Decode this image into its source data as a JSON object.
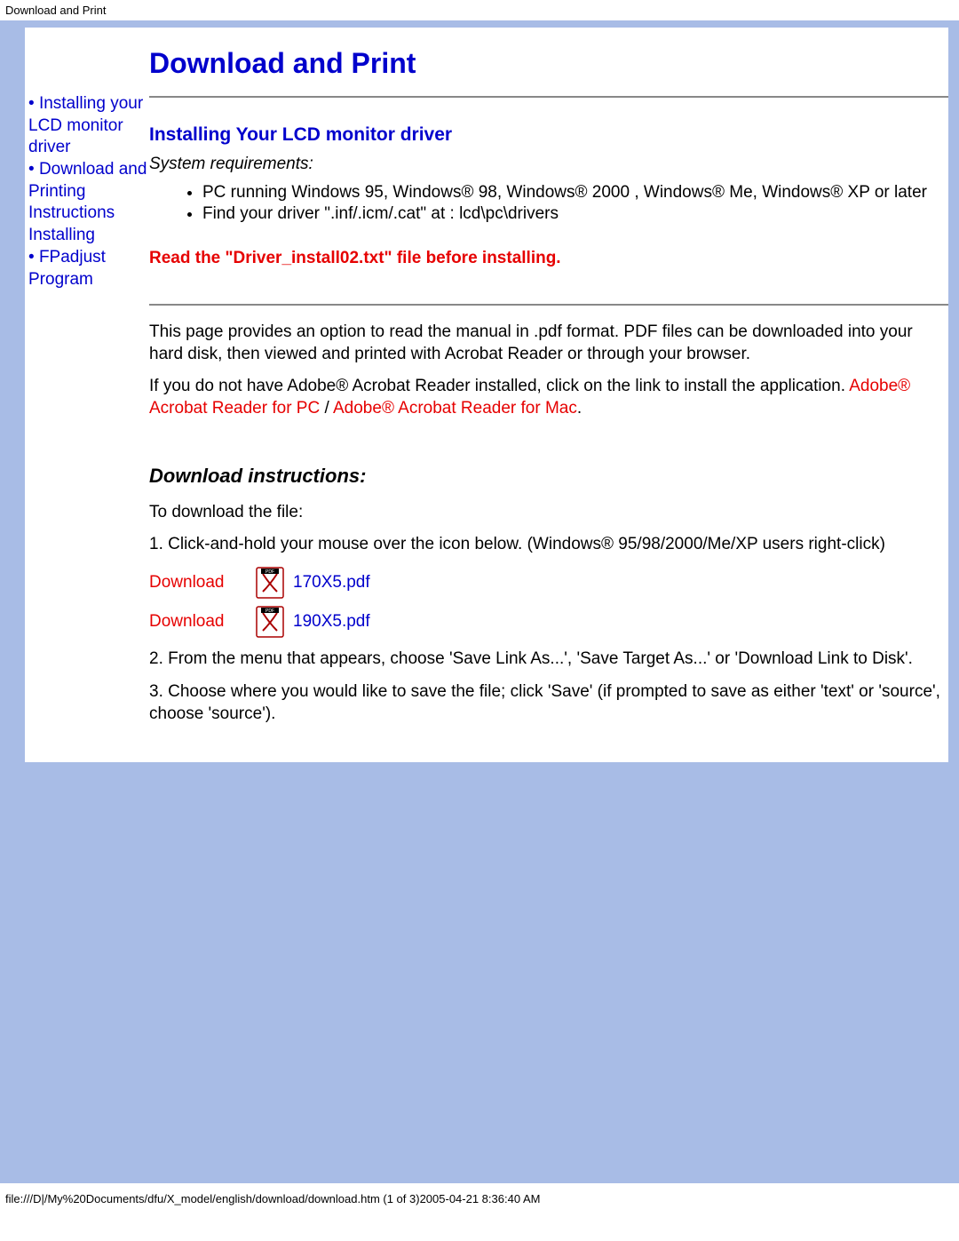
{
  "header": {
    "title_small": "Download and Print"
  },
  "sidebar": {
    "items": [
      {
        "label": "Installing your LCD monitor driver"
      },
      {
        "label": "Download and Printing Instructions Installing"
      },
      {
        "label": "FPadjust Program"
      }
    ]
  },
  "main": {
    "page_title": "Download and Print",
    "section1_title": "Installing Your LCD monitor driver",
    "system_requirements_label": "System requirements:",
    "requirements": [
      "PC running Windows 95, Windows® 98, Windows® 2000 , Windows® Me, Windows® XP or later",
      "Find your driver \".inf/.icm/.cat\" at : lcd\\pc\\drivers"
    ],
    "warning_text": "Read the \"Driver_install02.txt\" file before installing.",
    "para1": "This page provides an option to read the manual in .pdf format. PDF files can be downloaded into your hard disk, then viewed and printed with Acrobat Reader or through your browser.",
    "para2_a": "If you do not have Adobe® Acrobat Reader installed, click on the link to install the application. ",
    "acrobat_pc": "Adobe® Acrobat Reader for PC",
    "slash": " / ",
    "acrobat_mac": "Adobe® Acrobat Reader for Mac",
    "period": ".",
    "download_instructions_title": "Download instructions:",
    "to_download": "To download the file:",
    "step1": "1. Click-and-hold your mouse over the icon below. (Windows® 95/98/2000/Me/XP users right-click)",
    "downloads": [
      {
        "label": "Download",
        "file": "170X5.pdf"
      },
      {
        "label": "Download",
        "file": "190X5.pdf"
      }
    ],
    "step2": "2. From the menu that appears, choose 'Save Link As...', 'Save Target As...' or 'Download Link to Disk'.",
    "step3": "3. Choose where you would like to save the file; click 'Save' (if prompted to save as either 'text' or 'source', choose 'source')."
  },
  "footer": {
    "path": "file:///D|/My%20Documents/dfu/X_model/english/download/download.htm (1 of 3)2005-04-21 8:36:40 AM"
  }
}
